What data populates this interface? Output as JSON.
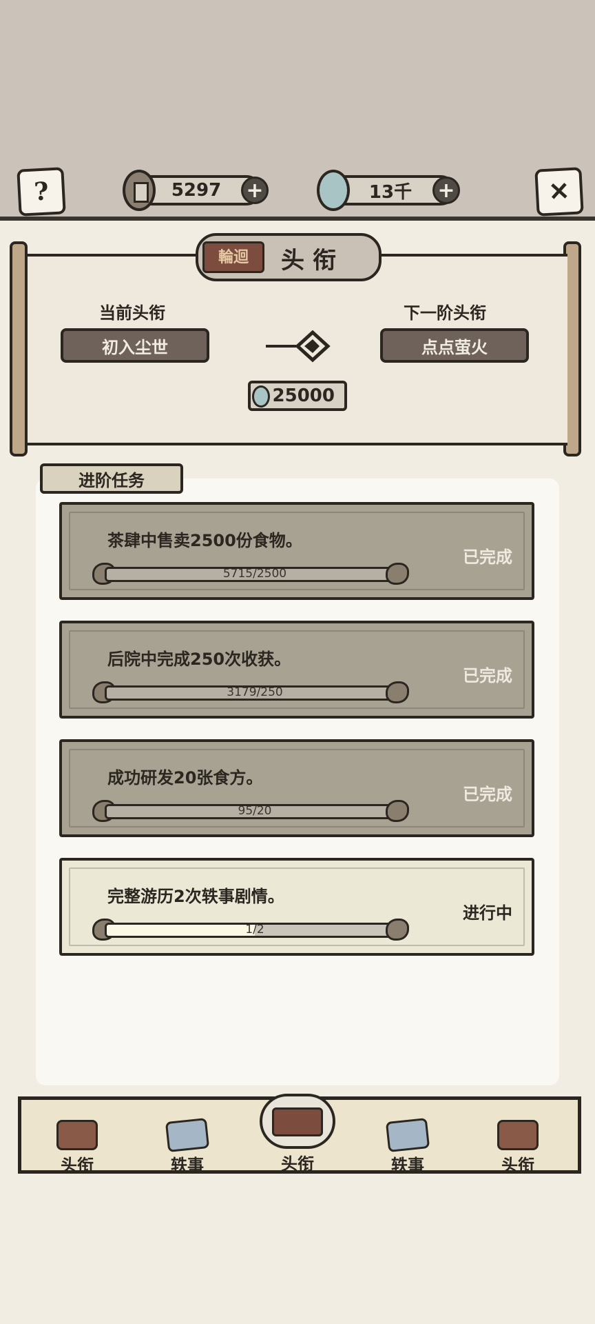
{
  "header": {
    "help_icon": "question-icon",
    "close_icon": "close-icon",
    "coins": {
      "value": "5297",
      "icon": "coin-icon"
    },
    "jade": {
      "value": "13千",
      "icon": "jade-icon"
    },
    "plus_label": "+"
  },
  "panel": {
    "title": "头衔",
    "current_label": "当前头衔",
    "current_rank": "初入尘世",
    "next_label": "下一阶头衔",
    "next_rank": "点点萤火",
    "cost": "25000"
  },
  "tasks": {
    "tab_label": "进阶任务",
    "items": [
      {
        "text": "茶肆中售卖2500份食物。",
        "progress": "5715/2500",
        "fill": 1.0,
        "status": "已完成",
        "done": true
      },
      {
        "text": "后院中完成250次收获。",
        "progress": "3179/250",
        "fill": 1.0,
        "status": "已完成",
        "done": true
      },
      {
        "text": "成功研发20张食方。",
        "progress": "95/20",
        "fill": 1.0,
        "status": "已完成",
        "done": true
      },
      {
        "text": "完整游历2次轶事剧情。",
        "progress": "1/2",
        "fill": 0.5,
        "status": "进行中",
        "done": false
      }
    ]
  },
  "nav": {
    "items": [
      {
        "label": "头衔",
        "icon": "seal-icon"
      },
      {
        "label": "轶事",
        "icon": "map-icon"
      },
      {
        "label": "头衔",
        "icon": "seal-icon",
        "active": true
      },
      {
        "label": "轶事",
        "icon": "map-icon"
      },
      {
        "label": "头衔",
        "icon": "seal-icon"
      }
    ]
  },
  "colors": {
    "ink": "#2b2620",
    "paper": "#f1ede3",
    "done_card": "#a8a293",
    "progress_card": "#ece8d6",
    "rank_button": "#6f625b"
  }
}
